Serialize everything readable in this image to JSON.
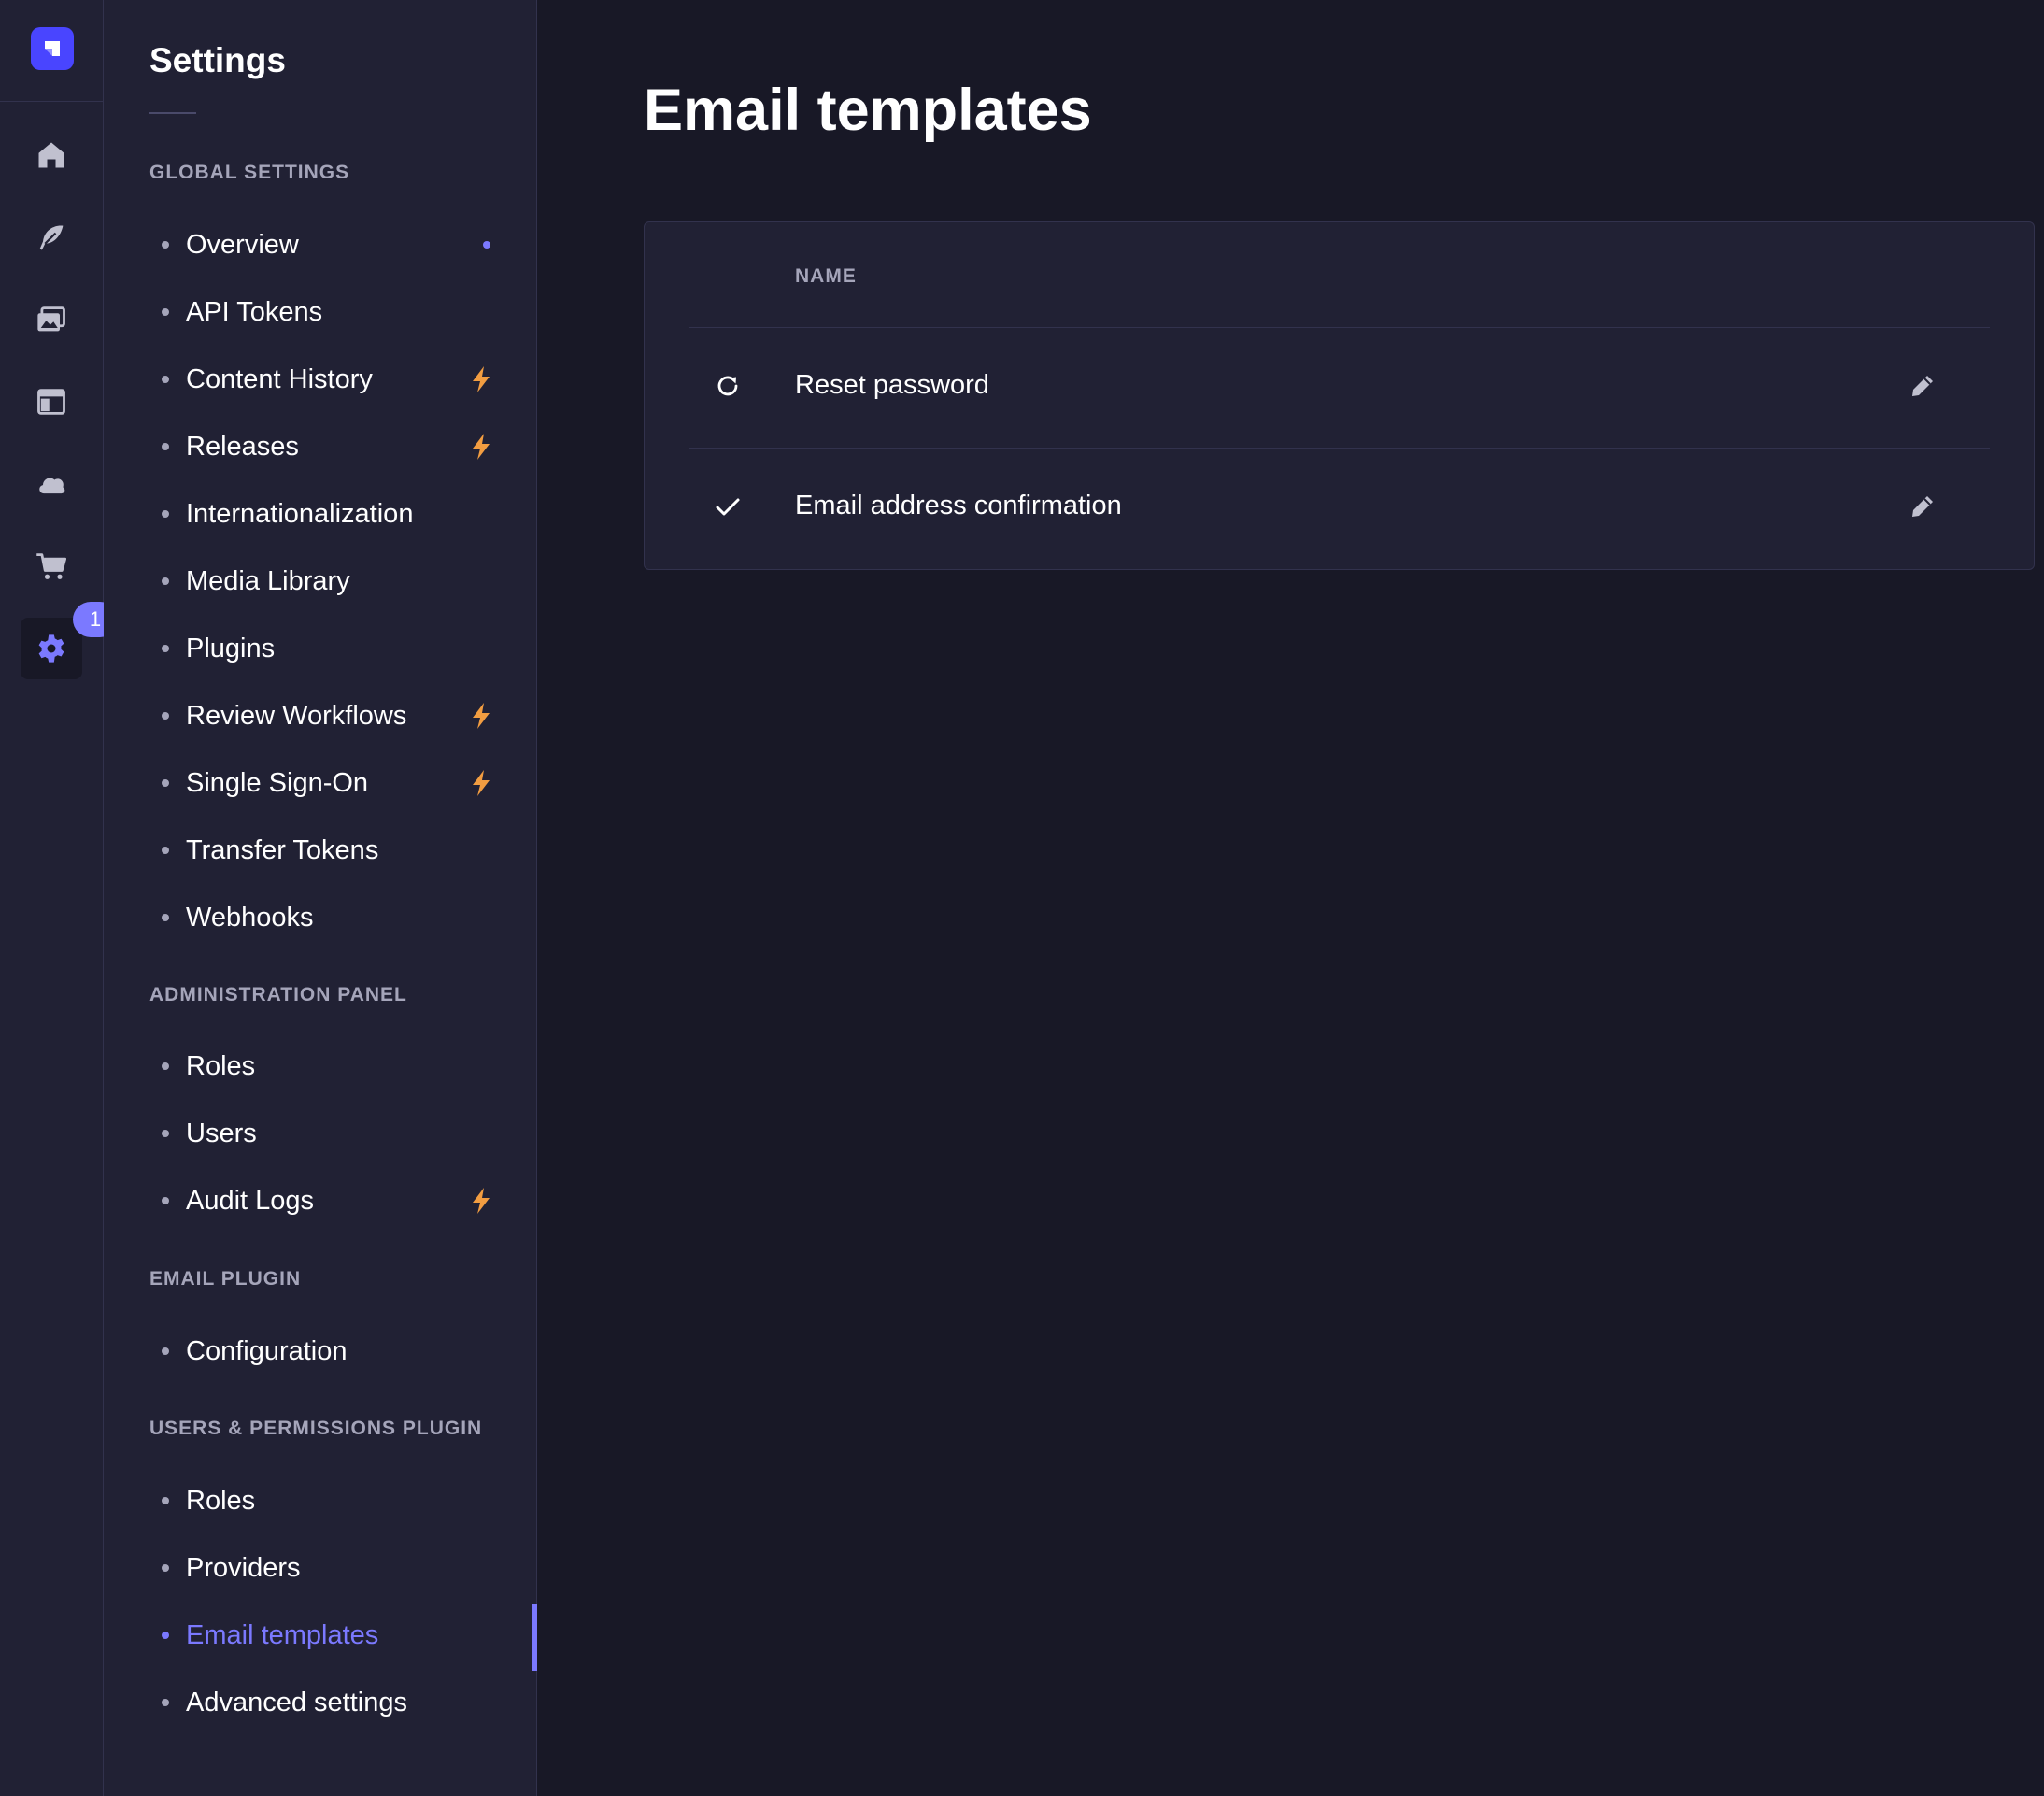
{
  "rail": {
    "items": [
      {
        "icon": "home-icon"
      },
      {
        "icon": "feather-icon"
      },
      {
        "icon": "media-icon"
      },
      {
        "icon": "layout-icon"
      },
      {
        "icon": "cloud-icon"
      },
      {
        "icon": "cart-icon"
      },
      {
        "icon": "gear-icon",
        "badge": "1"
      }
    ]
  },
  "subnav": {
    "title": "Settings",
    "sections": [
      {
        "label": "GLOBAL SETTINGS",
        "items": [
          {
            "label": "Overview",
            "marker": "new-dot"
          },
          {
            "label": "API Tokens"
          },
          {
            "label": "Content History",
            "marker": "bolt"
          },
          {
            "label": "Releases",
            "marker": "bolt"
          },
          {
            "label": "Internationalization"
          },
          {
            "label": "Media Library"
          },
          {
            "label": "Plugins"
          },
          {
            "label": "Review Workflows",
            "marker": "bolt"
          },
          {
            "label": "Single Sign-On",
            "marker": "bolt"
          },
          {
            "label": "Transfer Tokens"
          },
          {
            "label": "Webhooks"
          }
        ]
      },
      {
        "label": "ADMINISTRATION PANEL",
        "items": [
          {
            "label": "Roles"
          },
          {
            "label": "Users"
          },
          {
            "label": "Audit Logs",
            "marker": "bolt"
          }
        ]
      },
      {
        "label": "EMAIL PLUGIN",
        "items": [
          {
            "label": "Configuration"
          }
        ]
      },
      {
        "label": "USERS & PERMISSIONS PLUGIN",
        "items": [
          {
            "label": "Roles"
          },
          {
            "label": "Providers"
          },
          {
            "label": "Email templates",
            "active": true
          },
          {
            "label": "Advanced settings"
          }
        ]
      }
    ]
  },
  "main": {
    "title": "Email templates",
    "table": {
      "column_name": "NAME",
      "rows": [
        {
          "icon": "refresh-icon",
          "name": "Reset password"
        },
        {
          "icon": "check-icon",
          "name": "Email address confirmation"
        }
      ]
    }
  },
  "colors": {
    "background": "#181826",
    "panel": "#212134",
    "border": "#32324d",
    "accent": "#7b79ff",
    "brand": "#4945ff",
    "bolt": "#f29d41",
    "muted": "#a5a5ba"
  }
}
